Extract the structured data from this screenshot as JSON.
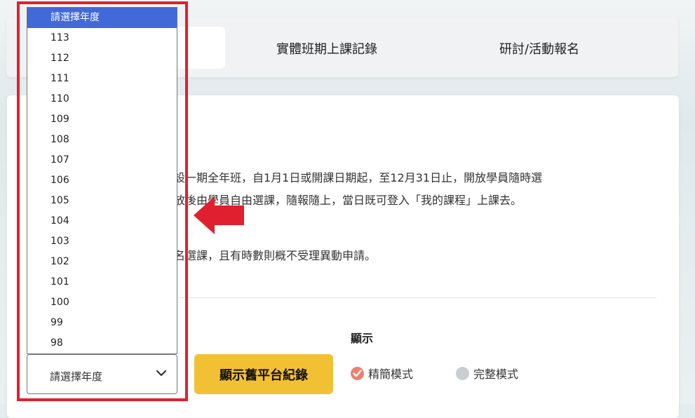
{
  "tabs": {
    "items": [
      {
        "label": ""
      },
      {
        "label": "實體班期上課記錄"
      },
      {
        "label": "研討/活動報名"
      }
    ]
  },
  "content": {
    "line1": "設一期全年班，自1月1日或開課日期起，至12月31日止，開放學員隨時選",
    "line2": "放後由學員自由選課，隨報隨上，當日既可登入「我的課程」上課去。",
    "line3": "名選課，且有時數則概不受理異動申請。"
  },
  "year_select": {
    "selected": "請選擇年度",
    "options": [
      "請選擇年度",
      "113",
      "112",
      "111",
      "110",
      "109",
      "108",
      "107",
      "106",
      "105",
      "104",
      "103",
      "102",
      "101",
      "100",
      "99",
      "98"
    ]
  },
  "buttons": {
    "show_old": "顯示舊平台紀錄"
  },
  "display": {
    "label": "顯示",
    "options": [
      {
        "label": "精簡模式",
        "checked": true
      },
      {
        "label": "完整模式",
        "checked": false
      }
    ]
  },
  "colors": {
    "accent_button": "#f2c033",
    "selected_option": "#4169d8",
    "highlight": "#e0202e",
    "radio_checked": "#f07e6e"
  },
  "icons": {
    "chevron": "chevron-down-icon",
    "arrow": "left-arrow-icon",
    "check": "check-icon"
  }
}
